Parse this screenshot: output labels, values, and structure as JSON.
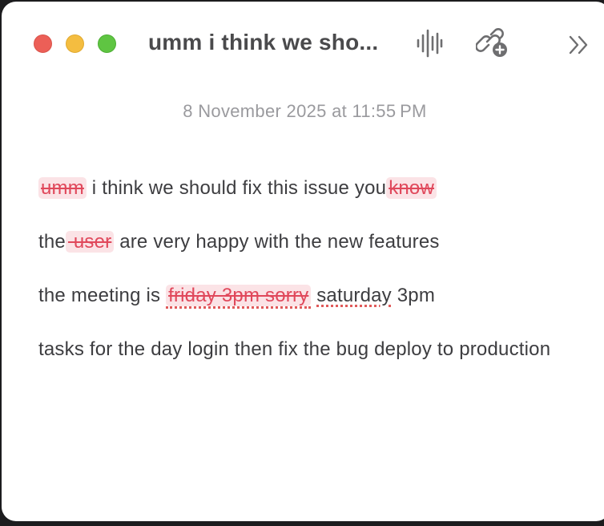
{
  "window": {
    "title": "umm i think we sho..."
  },
  "toolbar": {
    "icons": [
      "waveform-icon",
      "link-add-icon",
      "chevrons-right-icon"
    ]
  },
  "note": {
    "timestamp": "8 November 2025 at 11:55 PM",
    "paragraphs": [
      {
        "deleted_1": "umm",
        "text_1": " i think we should fix this issue you",
        "deleted_2": "know"
      },
      {
        "text_1": "the",
        "deleted_1": " user",
        "text_2": " are very happy with the new features"
      },
      {
        "text_1": "the meeting is ",
        "deleted_1": "friday 3pm sorry",
        "text_2": " ",
        "misspelled_1": "saturday",
        "text_3": " 3pm"
      },
      {
        "text_1": "tasks for the day  login then fix the bug deploy to production"
      }
    ]
  },
  "colors": {
    "deleted_text": "#e0485b",
    "deleted_background": "#fbe3e6",
    "close": "#ec5f57",
    "minimize": "#f4bd40",
    "zoom": "#5fc542"
  }
}
